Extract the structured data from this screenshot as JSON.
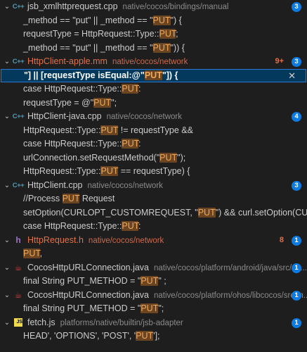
{
  "colors": {
    "background": "#1e1e1e",
    "badge": "#0e7be0",
    "modified": "#e2704b",
    "highlight": "#6b4522",
    "selection_border": "#2a7ad4"
  },
  "files": [
    {
      "icon": "cpp-icon",
      "icon_text": "C++",
      "name": "jsb_xmlhttprequest.cpp",
      "path": "native/cocos/bindings/manual",
      "modified": false,
      "mod_count": "",
      "count": "3",
      "matches": [
        {
          "pre": "_method == \"put\" || _method == \"",
          "hit": "PUT",
          "post": "\") {"
        },
        {
          "pre": "requestType = HttpRequest::Type::",
          "hit": "PUT",
          "post": ";"
        },
        {
          "pre": "_method == \"put\" || _method == \"",
          "hit": "PUT",
          "post": "\")) {"
        }
      ]
    },
    {
      "icon": "cpp-icon",
      "icon_text": "C++",
      "name": "HttpClient-apple.mm",
      "path": "native/cocos/network",
      "modified": true,
      "mod_count": "9+",
      "count": "3",
      "matches": [
        {
          "pre": "\"] || [requestType isEqual:@\"",
          "hit": "PUT",
          "post": "\"]) {",
          "selected": true,
          "dismiss": "✕"
        },
        {
          "pre": "case HttpRequest::Type::",
          "hit": "PUT",
          "post": ":"
        },
        {
          "pre": "requestType = @\"",
          "hit": "PUT",
          "post": "\";"
        }
      ]
    },
    {
      "icon": "cpp-icon",
      "icon_text": "C++",
      "name": "HttpClient-java.cpp",
      "path": "native/cocos/network",
      "modified": false,
      "mod_count": "",
      "count": "4",
      "matches": [
        {
          "pre": "HttpRequest::Type::",
          "hit": "PUT",
          "post": " != requestType &&"
        },
        {
          "pre": "case HttpRequest::Type::",
          "hit": "PUT",
          "post": ":"
        },
        {
          "pre": "urlConnection.setRequestMethod(\"",
          "hit": "PUT",
          "post": "\");"
        },
        {
          "pre": "HttpRequest::Type::",
          "hit": "PUT",
          "post": " == requestType) {"
        }
      ]
    },
    {
      "icon": "cpp-icon",
      "icon_text": "C++",
      "name": "HttpClient.cpp",
      "path": "native/cocos/network",
      "modified": false,
      "mod_count": "",
      "count": "3",
      "matches": [
        {
          "pre": "//Process ",
          "hit": "PUT",
          "post": " Request"
        },
        {
          "pre": "setOption(CURLOPT_CUSTOMREQUEST, \"",
          "hit": "PUT",
          "post": "\") && curl.setOption(CURLOPT..."
        },
        {
          "pre": "case HttpRequest::Type::",
          "hit": "PUT",
          "post": ":"
        }
      ]
    },
    {
      "icon": "h-icon",
      "icon_text": "h",
      "name": "HttpRequest.h",
      "path": "native/cocos/network",
      "modified": true,
      "mod_count": "8",
      "count": "1",
      "matches": [
        {
          "pre": "",
          "hit": "PUT",
          "post": ","
        }
      ]
    },
    {
      "icon": "java-icon",
      "icon_text": "☕",
      "name": "CocosHttpURLConnection.java",
      "path": "native/cocos/platform/android/java/src/co...",
      "modified": false,
      "mod_count": "",
      "count": "1",
      "matches": [
        {
          "pre": "final String PUT_METHOD = \"",
          "hit": "PUT",
          "post": "\" ;"
        }
      ]
    },
    {
      "icon": "java-icon",
      "icon_text": "☕",
      "name": "CocosHttpURLConnection.java",
      "path": "native/cocos/platform/ohos/libcocos/src/m...",
      "modified": false,
      "mod_count": "",
      "count": "1",
      "matches": [
        {
          "pre": "final String PUT_METHOD = \"",
          "hit": "PUT",
          "post": "\";"
        }
      ]
    },
    {
      "icon": "js-icon",
      "icon_text": "JS",
      "name": "fetch.js",
      "path": "platforms/native/builtin/jsb-adapter",
      "modified": false,
      "mod_count": "",
      "count": "1",
      "matches": [
        {
          "pre": "HEAD', 'OPTIONS', 'POST', '",
          "hit": "PUT",
          "post": "'];"
        }
      ]
    }
  ]
}
